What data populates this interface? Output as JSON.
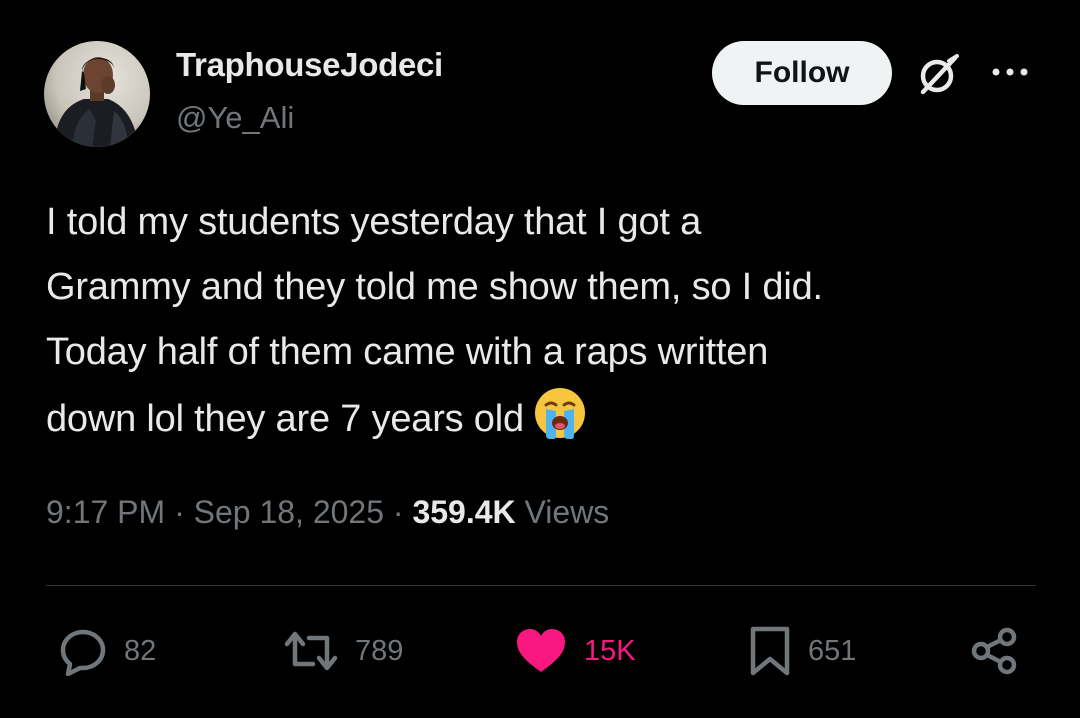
{
  "user": {
    "display_name": "TraphouseJodeci",
    "handle": "@Ye_Ali",
    "avatar_icon": "profile-photo"
  },
  "header": {
    "follow_label": "Follow",
    "grok_icon": "grok-icon",
    "more_icon": "more-dots-icon"
  },
  "tweet": {
    "lines": [
      "I told my students yesterday that I got a",
      "Grammy and they told me show them, so I did.",
      "Today half of them came with a raps written",
      "down lol they are 7 years old"
    ],
    "emoji": "loudly-crying-face"
  },
  "meta": {
    "time": "9:17 PM",
    "separator": "·",
    "date": "Sep 18, 2025",
    "views_count": "359.4K",
    "views_label": "Views"
  },
  "actions": {
    "replies": "82",
    "reposts": "789",
    "likes": "15K",
    "bookmarks": "651"
  },
  "colors": {
    "background": "#000000",
    "text_primary": "#e7e9ea",
    "text_secondary": "#71767b",
    "like_active": "#f91880",
    "divider": "#2f3336"
  }
}
